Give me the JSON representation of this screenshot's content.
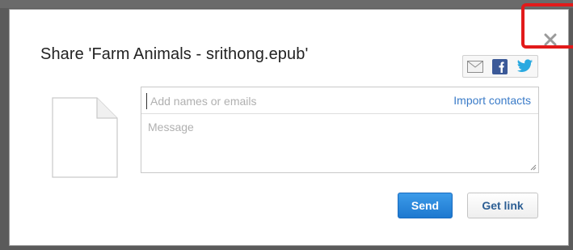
{
  "dialog": {
    "title": "Share 'Farm Animals - srithong.epub'",
    "close_icon": "close-icon",
    "share_icons": [
      "email-icon",
      "facebook-icon",
      "twitter-icon"
    ]
  },
  "form": {
    "to_placeholder": "Add names or emails",
    "import_label": "Import contacts",
    "message_placeholder": "Message"
  },
  "buttons": {
    "send_label": "Send",
    "link_label": "Get link"
  },
  "colors": {
    "accent": "#1d78cf",
    "link": "#3a7bc8",
    "highlight": "#e21a1a"
  }
}
